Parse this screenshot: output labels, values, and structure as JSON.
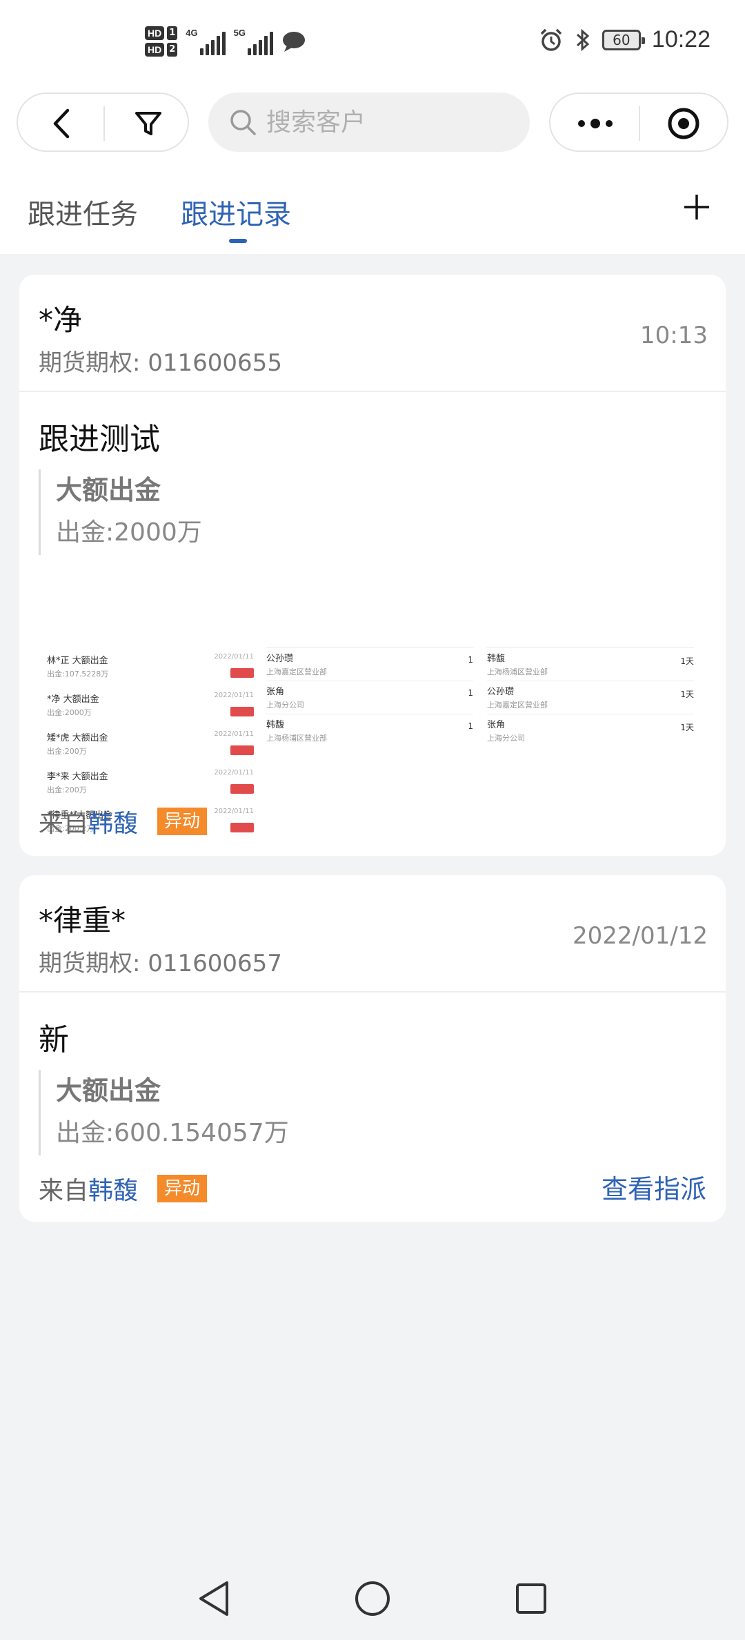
{
  "status_bar": {
    "hd1": "HD",
    "hd1_num": "1",
    "hd2": "HD",
    "hd2_num": "2",
    "net1": "4G",
    "net2": "5G",
    "battery": "60",
    "time": "10:22"
  },
  "search": {
    "placeholder": "搜索客户"
  },
  "tabs": [
    {
      "label": "跟进任务"
    },
    {
      "label": "跟进记录",
      "active": true
    }
  ],
  "records": [
    {
      "customer_name": "*净",
      "account": "期货期权: 011600655",
      "time": "10:13",
      "note_title": "跟进测试",
      "quote_title": "大额出金",
      "quote_body": "出金:2000万",
      "from_label": "来自",
      "from_name": "韩馥",
      "tag": "异动",
      "screenshot": {
        "list": [
          {
            "name": "林*正  大额出金",
            "sub": "出金:107.5228万",
            "date": "2022/01/11"
          },
          {
            "name": "*净  大额出金",
            "sub": "出金:2000万",
            "date": "2022/01/11"
          },
          {
            "name": "矮*虎  大额出金",
            "sub": "出金:200万",
            "date": "2022/01/11"
          },
          {
            "name": "李*来  大额出金",
            "sub": "出金:200万",
            "date": "2022/01/11"
          },
          {
            "name": "*律重*  大额出金",
            "sub": "出金:200.2万",
            "date": "2022/01/11"
          }
        ],
        "col2": [
          {
            "name": "公孙瓒",
            "sub": "上海嘉定区营业部",
            "num": "1"
          },
          {
            "name": "张角",
            "sub": "上海分公司",
            "num": "1"
          },
          {
            "name": "韩馥",
            "sub": "上海杨浦区营业部",
            "num": "1"
          }
        ],
        "col3": [
          {
            "name": "韩馥",
            "sub": "上海杨浦区营业部",
            "num": "1天"
          },
          {
            "name": "公孙瓒",
            "sub": "上海嘉定区营业部",
            "num": "1天"
          },
          {
            "name": "张角",
            "sub": "上海分公司",
            "num": "1天"
          }
        ]
      }
    },
    {
      "customer_name": "*律重*",
      "account": "期货期权: 011600657",
      "time": "2022/01/12",
      "note_title": "新",
      "quote_title": "大额出金",
      "quote_body": "出金:600.154057万",
      "from_label": "来自",
      "from_name": "韩馥",
      "tag": "异动",
      "action": "查看指派"
    }
  ],
  "colors": {
    "accent": "#2f63b5",
    "tag": "#f48a2a",
    "badge": "#e24b4b"
  }
}
